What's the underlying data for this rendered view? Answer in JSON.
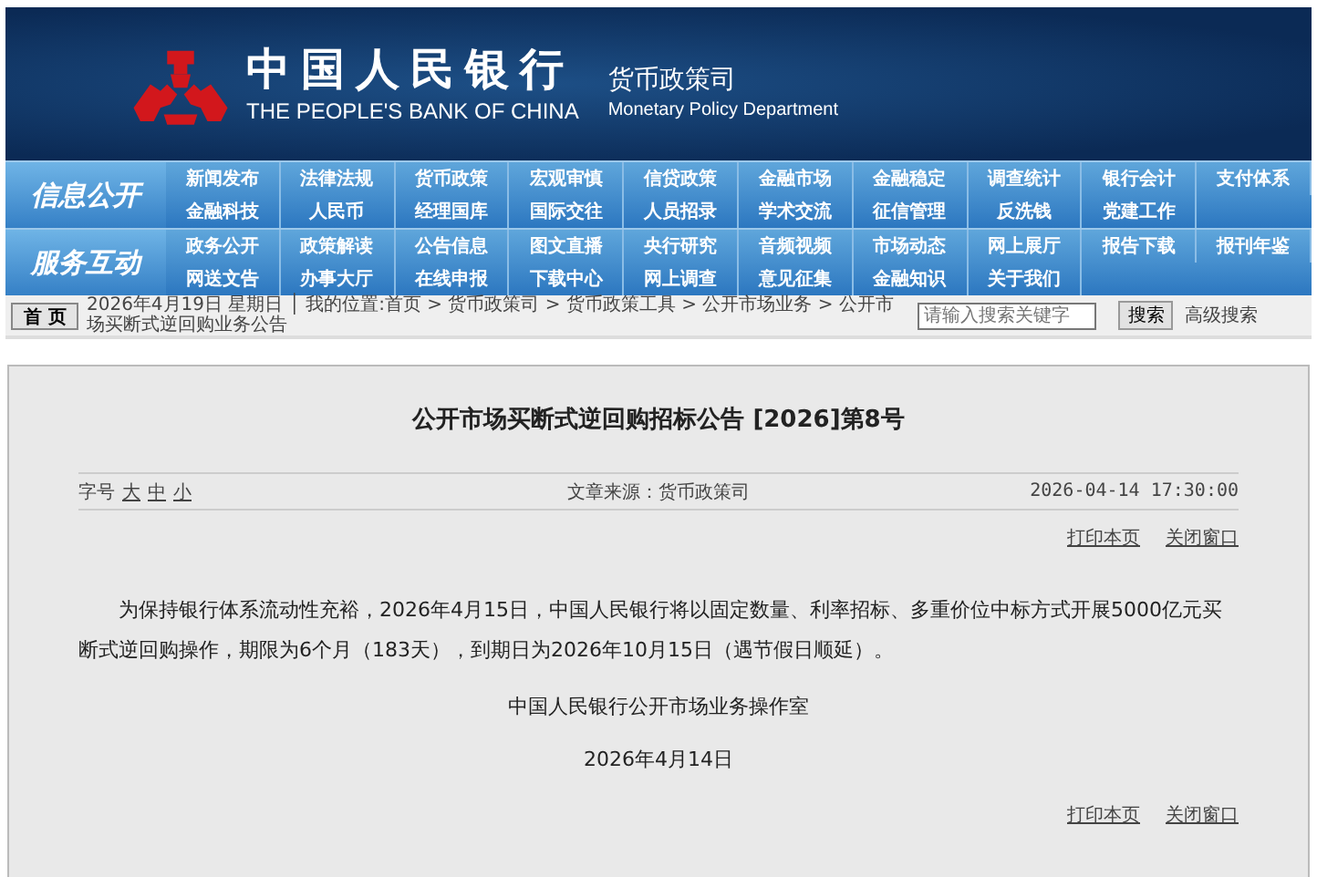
{
  "header": {
    "bank_name_cn": "中国人民银行",
    "bank_name_en": "THE PEOPLE'S BANK OF CHINA",
    "department_cn": "货币政策司",
    "department_en": "Monetary Policy Department"
  },
  "nav_groups": [
    {
      "label": "信息公开",
      "rows": [
        [
          "新闻发布",
          "法律法规",
          "货币政策",
          "宏观审慎",
          "信贷政策",
          "金融市场",
          "金融稳定",
          "调查统计",
          "银行会计",
          "支付体系"
        ],
        [
          "金融科技",
          "人民币",
          "经理国库",
          "国际交往",
          "人员招录",
          "学术交流",
          "征信管理",
          "反洗钱",
          "党建工作"
        ]
      ]
    },
    {
      "label": "服务互动",
      "rows": [
        [
          "政务公开",
          "政策解读",
          "公告信息",
          "图文直播",
          "央行研究",
          "音频视频",
          "市场动态",
          "网上展厅",
          "报告下载",
          "报刊年鉴"
        ],
        [
          "网送文告",
          "办事大厅",
          "在线申报",
          "下载中心",
          "网上调查",
          "意见征集",
          "金融知识",
          "关于我们"
        ]
      ]
    }
  ],
  "breadcrumb": {
    "home_button": "首 页",
    "text": "2026年4月19日 星期日 │ 我的位置:首页 > 货币政策司 > 货币政策工具 > 公开市场业务 > 公开市场买断式逆回购业务公告"
  },
  "search": {
    "placeholder": "请输入搜索关键字",
    "button": "搜索",
    "advanced": "高级搜索"
  },
  "article": {
    "title": "公开市场买断式逆回购招标公告 [2026]第8号",
    "font_size_label": "字号",
    "font_sizes": [
      "大",
      "中",
      "小"
    ],
    "source": "文章来源：货币政策司",
    "datetime": "2026-04-14 17:30:00",
    "body": "为保持银行体系流动性充裕，2026年4月15日，中国人民银行将以固定数量、利率招标、多重价位中标方式开展5000亿元买断式逆回购操作，期限为6个月（183天），到期日为2026年10月15日（遇节假日顺延）。",
    "signature": "中国人民银行公开市场业务操作室",
    "date": "2026年4月14日",
    "top_links": [
      "打印本页",
      "关闭窗口"
    ],
    "bottom_links": [
      "打印本页",
      "关闭窗口"
    ]
  }
}
